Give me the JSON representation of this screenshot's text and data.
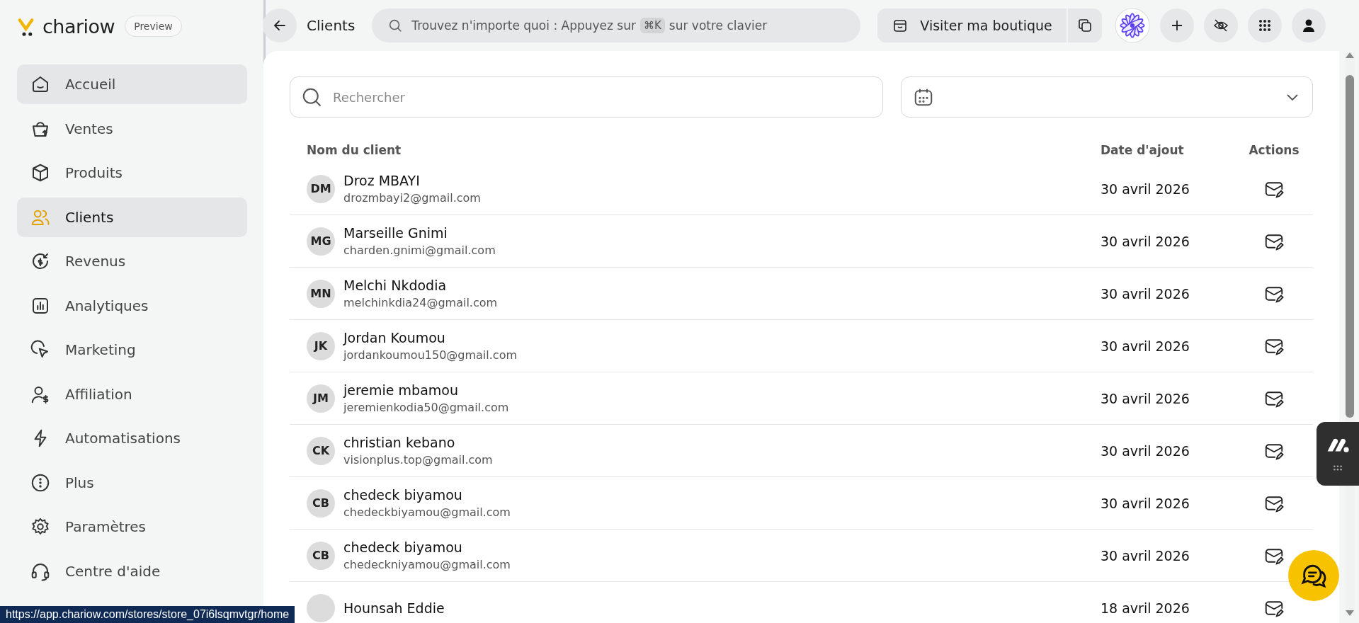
{
  "brand": {
    "name": "chariow",
    "badge": "Preview"
  },
  "topbar": {
    "title": "Clients",
    "search": {
      "before": "Trouvez n'importe quoi : Appuyez sur",
      "shortcut": "⌘K",
      "after": "sur votre clavier"
    },
    "shop_button": "Visiter ma boutique"
  },
  "sidebar": {
    "items": [
      {
        "label": "Accueil",
        "selected": false,
        "hovered": true
      },
      {
        "label": "Ventes",
        "selected": false,
        "hovered": false
      },
      {
        "label": "Produits",
        "selected": false,
        "hovered": false
      },
      {
        "label": "Clients",
        "selected": true,
        "hovered": false
      },
      {
        "label": "Revenus",
        "selected": false,
        "hovered": false
      },
      {
        "label": "Analytiques",
        "selected": false,
        "hovered": false
      },
      {
        "label": "Marketing",
        "selected": false,
        "hovered": false
      },
      {
        "label": "Affiliation",
        "selected": false,
        "hovered": false
      },
      {
        "label": "Automatisations",
        "selected": false,
        "hovered": false
      },
      {
        "label": "Plus",
        "selected": false,
        "hovered": false
      },
      {
        "label": "Paramètres",
        "selected": false,
        "hovered": false
      },
      {
        "label": "Centre d'aide",
        "selected": false,
        "hovered": false
      }
    ]
  },
  "filters": {
    "search": {
      "placeholder": "Rechercher"
    }
  },
  "table": {
    "columns": [
      "Nom du client",
      "Date d'ajout",
      "Actions"
    ],
    "rows": [
      {
        "initials": "DM",
        "name": "Droz MBAYI",
        "email": "drozmbayi2@gmail.com",
        "date": "30 avril 2026"
      },
      {
        "initials": "MG",
        "name": "Marseille Gnimi",
        "email": "charden.gnimi@gmail.com",
        "date": "30 avril 2026"
      },
      {
        "initials": "MN",
        "name": "Melchi Nkdodia",
        "email": "melchinkdia24@gmail.com",
        "date": "30 avril 2026"
      },
      {
        "initials": "JK",
        "name": "Jordan Koumou",
        "email": "jordankoumou150@gmail.com",
        "date": "30 avril 2026"
      },
      {
        "initials": "JM",
        "name": "jeremie mbamou",
        "email": "jeremienkodia50@gmail.com",
        "date": "30 avril 2026"
      },
      {
        "initials": "CK",
        "name": "christian kebano",
        "email": "visionplus.top@gmail.com",
        "date": "30 avril 2026"
      },
      {
        "initials": "CB",
        "name": "chedeck biyamou",
        "email": "chedeckbiyamou@gmail.com",
        "date": "30 avril 2026"
      },
      {
        "initials": "CB",
        "name": "chedeck biyamou",
        "email": "chedeckniyamou@gmail.com",
        "date": "30 avril 2026"
      },
      {
        "name": "Hounsah Eddie",
        "date": "18 avril 2026"
      }
    ]
  },
  "status_bar": {
    "url": "https://app.chariow.com/stores/store_07i6lsqmvtgr/home"
  }
}
